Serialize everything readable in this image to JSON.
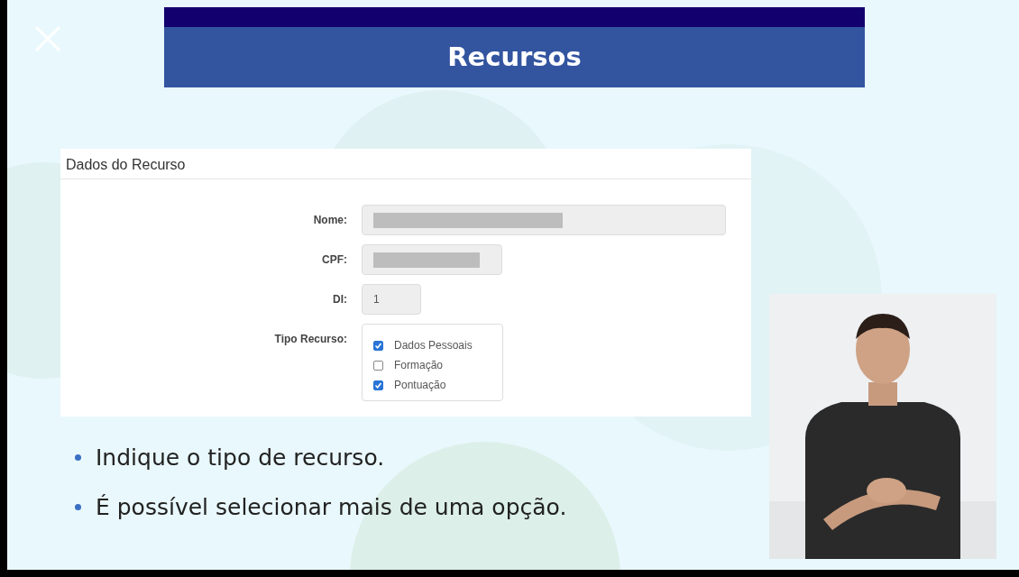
{
  "slide": {
    "title": "Recursos"
  },
  "form": {
    "title": "Dados do Recurso",
    "fields": [
      {
        "kind": "redacted",
        "label": "Nome:"
      },
      {
        "kind": "redacted",
        "label": "CPF:"
      },
      {
        "kind": "text",
        "label": "DI:",
        "value": "1"
      },
      {
        "kind": "checks",
        "label": "Tipo Recurso:",
        "options": [
          {
            "label": "Dados Pessoais",
            "checked": true
          },
          {
            "label": "Formação",
            "checked": false
          },
          {
            "label": "Pontuação",
            "checked": true
          }
        ]
      }
    ]
  },
  "bullets": [
    "Indique o tipo de recurso.",
    "É possível selecionar mais de uma opção."
  ],
  "interpreter": {
    "kind": "picture"
  }
}
